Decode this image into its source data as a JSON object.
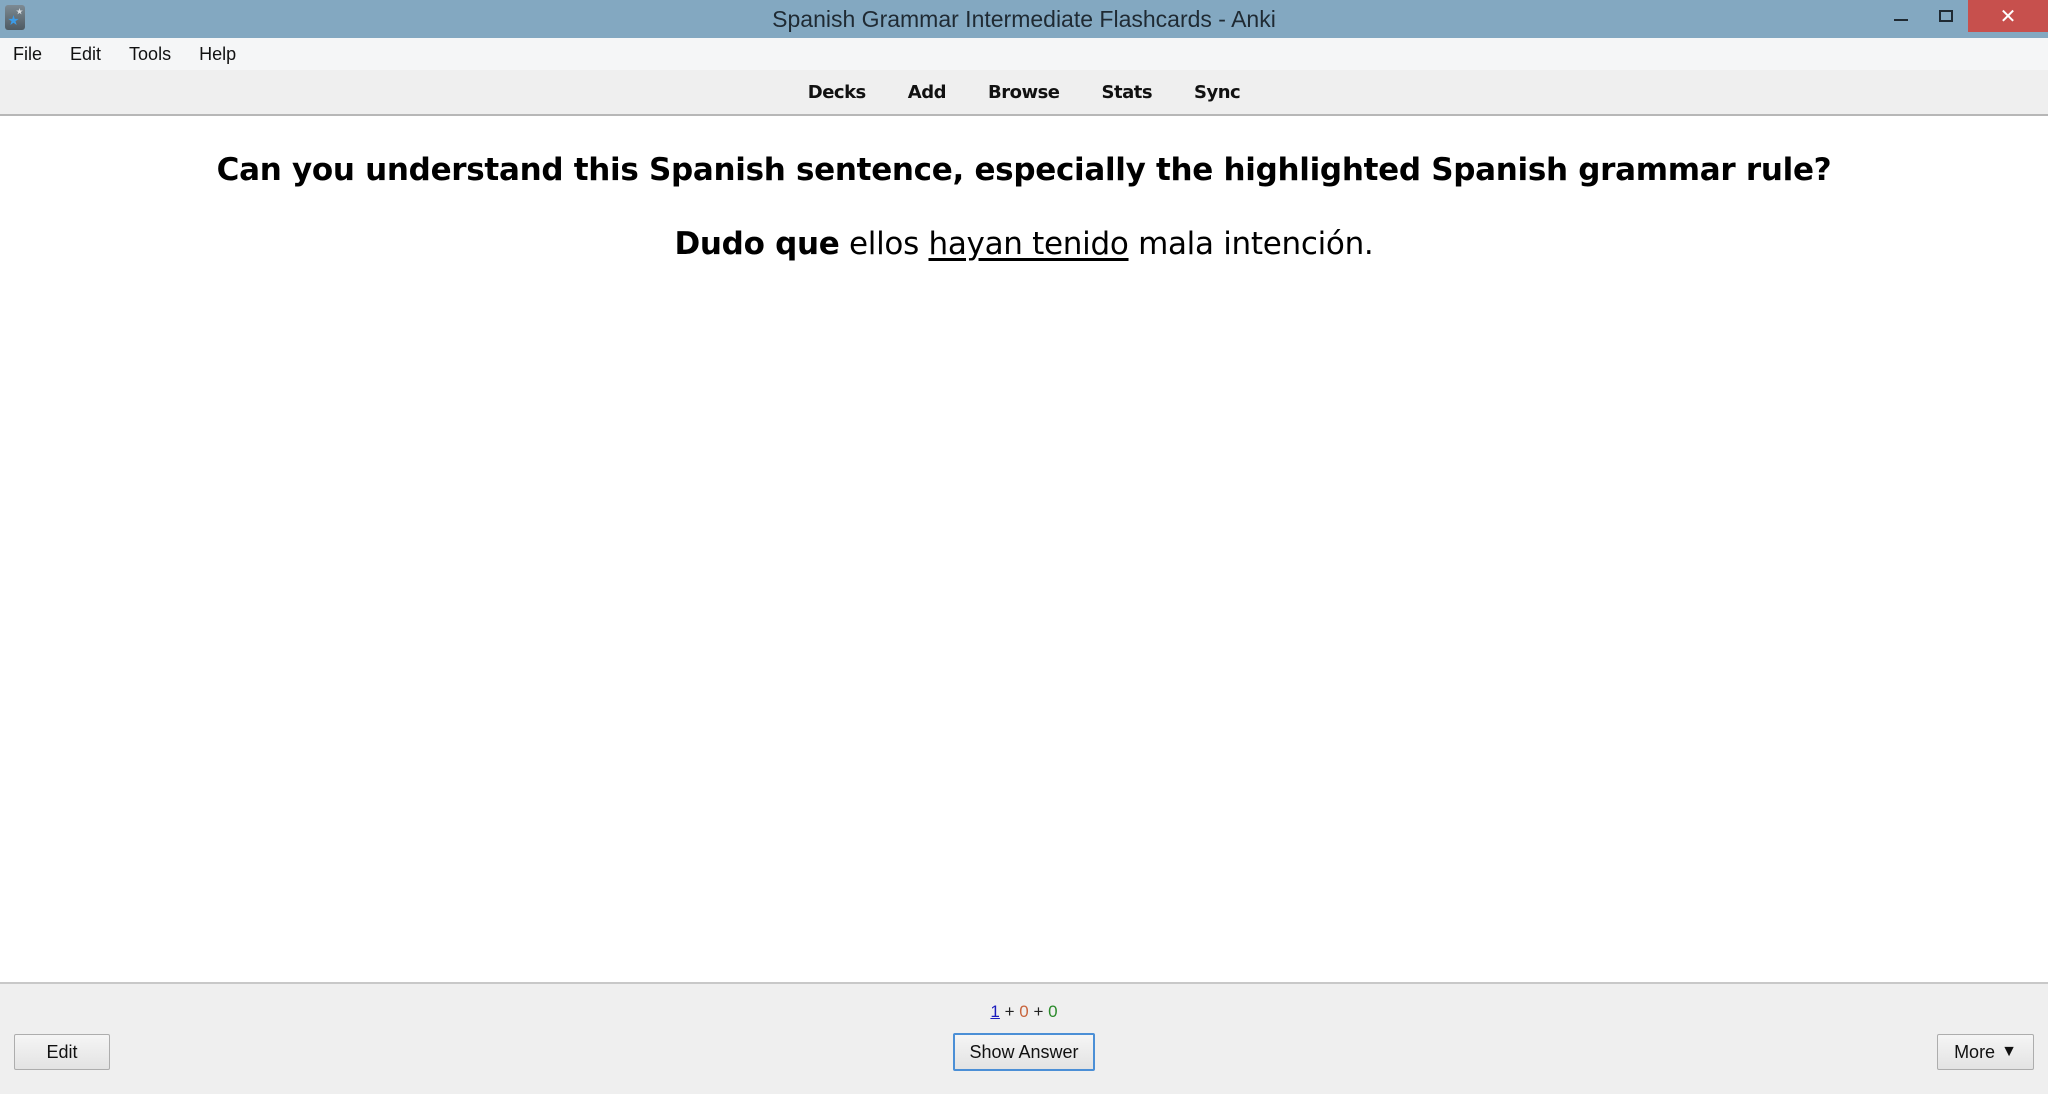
{
  "window": {
    "title": "Spanish Grammar Intermediate Flashcards - Anki",
    "controls": {
      "minimize_icon": "minimize-icon",
      "maximize_icon": "restore-icon",
      "close_glyph": "✕"
    }
  },
  "menubar": {
    "items": [
      {
        "label": "File"
      },
      {
        "label": "Edit"
      },
      {
        "label": "Tools"
      },
      {
        "label": "Help"
      }
    ]
  },
  "toolbar": {
    "links": [
      {
        "label": "Decks"
      },
      {
        "label": "Add"
      },
      {
        "label": "Browse"
      },
      {
        "label": "Stats"
      },
      {
        "label": "Sync"
      }
    ]
  },
  "card": {
    "question": "Can you understand this Spanish sentence, especially the highlighted Spanish grammar rule?",
    "sentence": {
      "bold_part": "Dudo que",
      "plain_part_1": " ellos ",
      "underlined_part": "hayan tenido",
      "plain_part_2": " mala intención."
    }
  },
  "bottombar": {
    "counts": {
      "new": "1",
      "learning": "0",
      "review": "0",
      "separator": " + "
    },
    "colors": {
      "new": "#1d1dbd",
      "learning": "#c8643c",
      "review": "#2a8a2a"
    },
    "edit_label": "Edit",
    "show_answer_label": "Show Answer",
    "more_label": "More",
    "more_arrow": "▼"
  }
}
